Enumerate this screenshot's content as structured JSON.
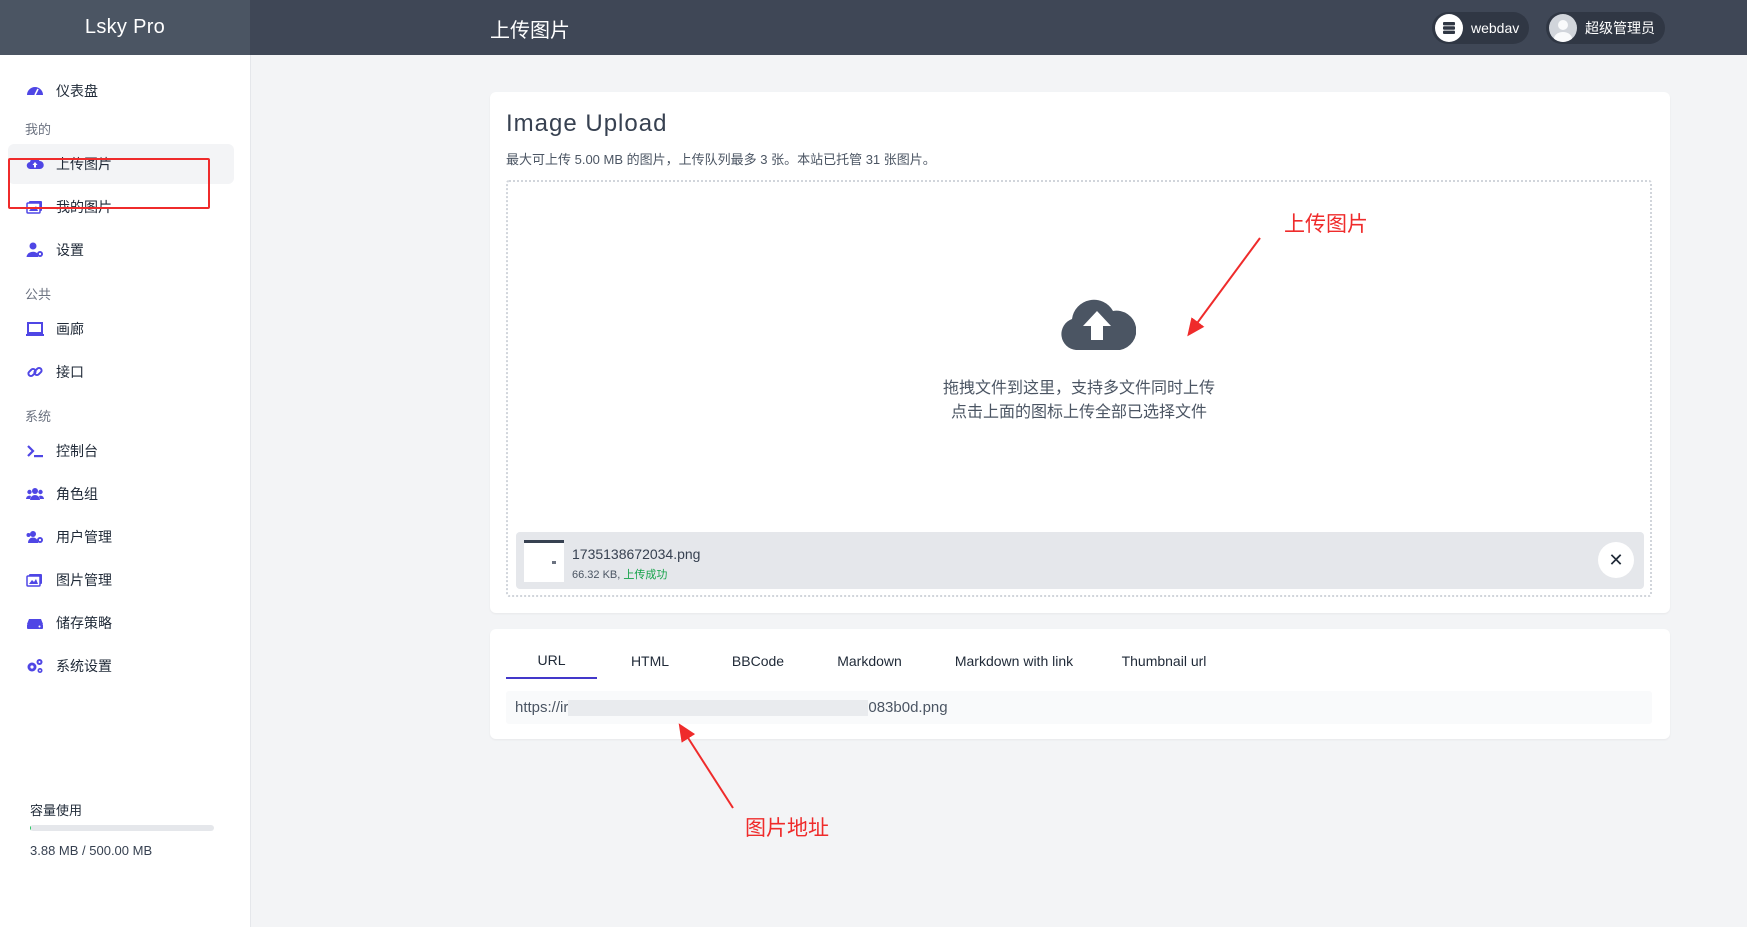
{
  "brand": "Lsky Pro",
  "header": {
    "title": "上传图片",
    "storage_label": "webdav",
    "user_name": "超级管理员"
  },
  "sidebar": {
    "dashboard": "仪表盘",
    "section_mine": "我的",
    "upload": "上传图片",
    "my_images": "我的图片",
    "settings": "设置",
    "section_public": "公共",
    "gallery": "画廊",
    "api": "接口",
    "section_system": "系统",
    "console": "控制台",
    "role_groups": "角色组",
    "user_management": "用户管理",
    "image_management": "图片管理",
    "storage_strategy": "储存策略",
    "system_settings": "系统设置",
    "capacity_title": "容量使用",
    "capacity_text": "3.88 MB / 500.00 MB",
    "capacity_fraction": 0.0078
  },
  "upload": {
    "title": "Image Upload",
    "subtitle": "最大可上传 5.00 MB 的图片，上传队列最多 3 张。本站已托管 31 张图片。",
    "drop_text_1": "拖拽文件到这里，支持多文件同时上传",
    "drop_text_2": "点击上面的图标上传全部已选择文件",
    "file": {
      "name": "1735138672034.png",
      "size": "66.32 KB, ",
      "status": "上传成功",
      "remove": "✕"
    }
  },
  "links": {
    "tabs": [
      "URL",
      "HTML",
      "BBCode",
      "Markdown",
      "Markdown with link",
      "Thumbnail url"
    ],
    "url_start": "https://ir",
    "url_end": "083b0d.png"
  },
  "annotations": {
    "upload_label": "上传图片",
    "url_label": "图片地址"
  },
  "colors": {
    "accent": "#4338ca",
    "annotation": "#ef2b2b",
    "success": "#16a34a"
  }
}
